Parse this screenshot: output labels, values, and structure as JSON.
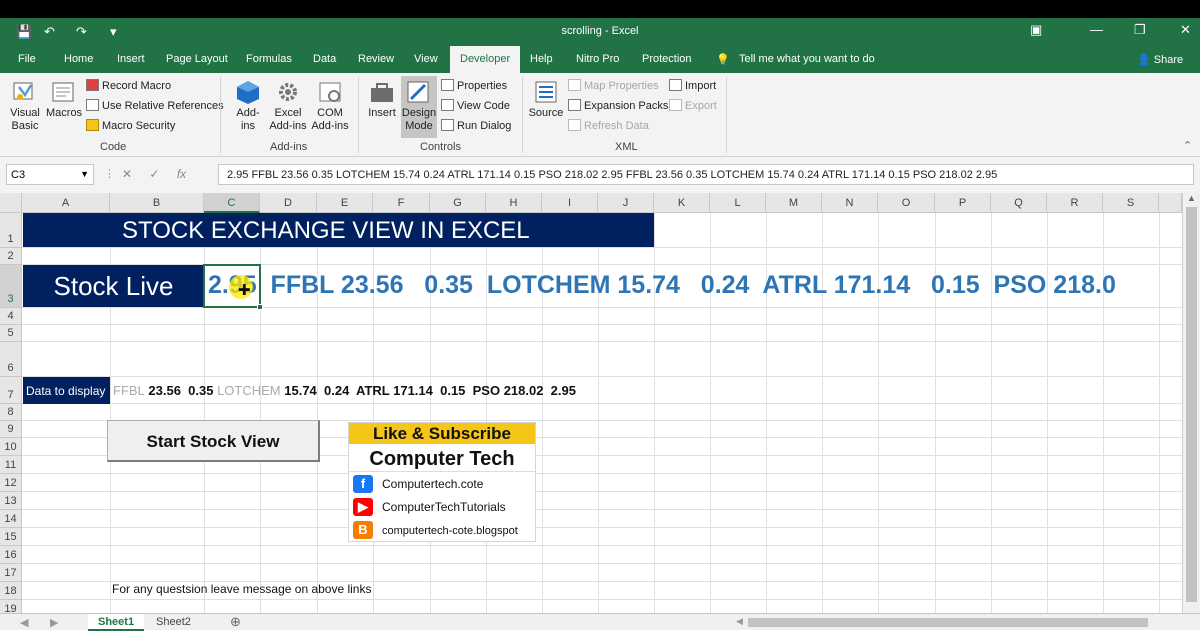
{
  "window": {
    "title": "scrolling  -  Excel"
  },
  "tabs": [
    "File",
    "Home",
    "Insert",
    "Page Layout",
    "Formulas",
    "Data",
    "Review",
    "View",
    "Developer",
    "Help",
    "Nitro Pro",
    "Protection"
  ],
  "active_tab": "Developer",
  "tell_me": "Tell me what you want to do",
  "share": "Share",
  "ribbon": {
    "code": {
      "visual_basic": "Visual Basic",
      "macros": "Macros",
      "record_macro": "Record Macro",
      "use_relative": "Use Relative References",
      "macro_security": "Macro Security",
      "label": "Code"
    },
    "addins": {
      "addins": "Add-ins",
      "excel_addins": "Excel Add-ins",
      "com_addins": "COM Add-ins",
      "label": "Add-ins"
    },
    "controls": {
      "insert": "Insert",
      "design_mode": "Design Mode",
      "properties": "Properties",
      "view_code": "View Code",
      "run_dialog": "Run Dialog",
      "label": "Controls"
    },
    "xml": {
      "source": "Source",
      "map_properties": "Map Properties",
      "expansion_packs": "Expansion Packs",
      "refresh_data": "Refresh Data",
      "import": "Import",
      "export": "Export",
      "label": "XML"
    }
  },
  "formula_bar": {
    "name_box": "C3",
    "fx": "fx",
    "content": "2.95 FFBL 23.56  0.35  LOTCHEM 15.74  0.24  ATRL 171.14  0.15  PSO 218.02  2.95 FFBL 23.56  0.35  LOTCHEM 15.74  0.24  ATRL 171.14  0.15  PSO 218.02  2.95"
  },
  "columns": [
    "A",
    "B",
    "C",
    "D",
    "E",
    "F",
    "G",
    "H",
    "I",
    "J",
    "K",
    "L",
    "M",
    "N",
    "O",
    "P",
    "Q",
    "R",
    "S"
  ],
  "rows": [
    "1",
    "2",
    "3",
    "4",
    "5",
    "6",
    "7",
    "8",
    "9",
    "10",
    "11",
    "12",
    "13",
    "14",
    "15",
    "16",
    "17",
    "18",
    "19"
  ],
  "sheet": {
    "banner": "STOCK EXCHANGE VIEW IN EXCEL",
    "stock_live": "Stock Live",
    "ticker": "2.95  FFBL 23.56   0.35  LOTCHEM 15.74   0.24  ATRL 171.14   0.15  PSO 218.0",
    "data_to_display_label": "Data to display",
    "data_faded_1": "FFBL",
    "data_part_1": " 23.56  0.35 ",
    "data_faded_2": "LOTCHEM",
    "data_part_2": " 15.74  0.24  ATRL 171.14  0.15  PSO 218.02  2.95",
    "start_button": "Start Stock View",
    "footnote": "For any questsion leave message on above links"
  },
  "promo": {
    "header": "Like & Subscribe",
    "title": "Computer Tech",
    "facebook": "Computertech.cote",
    "youtube": "ComputerTechTutorials",
    "blogger": "computertech-cote.blogspot"
  },
  "sheet_tabs": [
    "Sheet1",
    "Sheet2"
  ],
  "colors": {
    "excel_green": "#217346",
    "navy": "#002060",
    "ticker_blue": "#2e75b6",
    "promo_yellow": "#f5c518"
  }
}
